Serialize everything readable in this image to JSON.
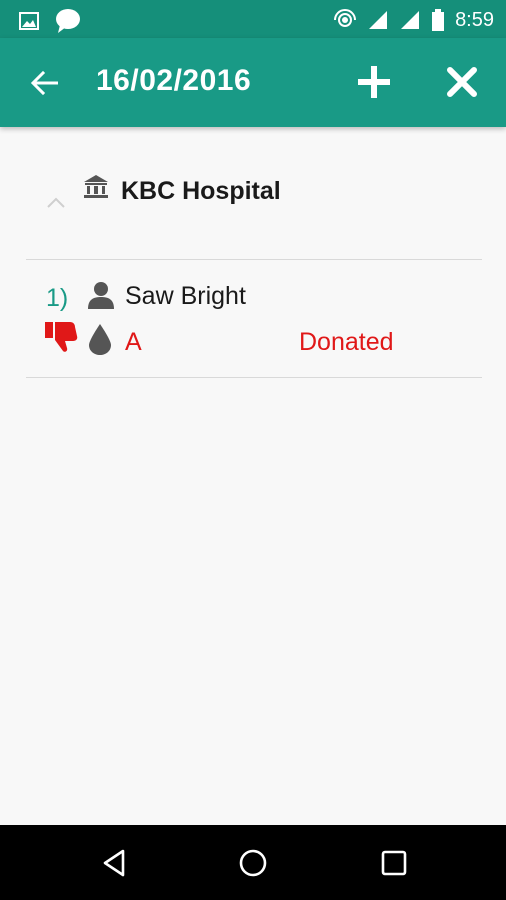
{
  "status_bar": {
    "time": "8:59",
    "icons": [
      "image-icon",
      "chat-icon",
      "hotspot-icon",
      "signal-icon",
      "signal-icon",
      "battery-icon"
    ]
  },
  "app_bar": {
    "title": "16/02/2016",
    "icons": [
      "back-arrow-icon",
      "add-icon",
      "close-icon"
    ],
    "color": "#199a86"
  },
  "hospital": {
    "name": "KBC Hospital",
    "icon": "hospital-icon"
  },
  "donors": [
    {
      "index": "1)",
      "name": "Saw Bright",
      "blood_group": "A",
      "status": "Donated",
      "icons": [
        "person-icon",
        "thumbs-down-icon",
        "blood-drop-icon"
      ]
    }
  ],
  "colors": {
    "accent": "#199a86",
    "status_red": "#e01818"
  },
  "nav_bar": {
    "buttons": [
      "back-triangle-icon",
      "home-circle-icon",
      "recents-square-icon"
    ]
  }
}
